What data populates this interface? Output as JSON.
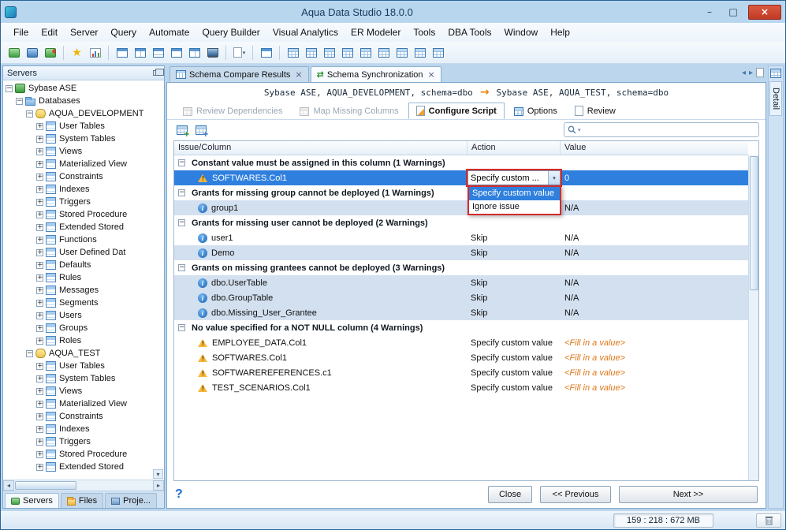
{
  "window": {
    "title": "Aqua Data Studio 18.0.0"
  },
  "titlebar": {
    "minimize": "–",
    "maximize": "□",
    "close": "×"
  },
  "menu": {
    "items": [
      "File",
      "Edit",
      "Server",
      "Query",
      "Automate",
      "Query Builder",
      "Visual Analytics",
      "ER Modeler",
      "Tools",
      "DBA Tools",
      "Window",
      "Help"
    ]
  },
  "toolbar": {
    "groups": [
      {
        "icons": [
          {
            "name": "register-server",
            "type": "server"
          },
          {
            "name": "connect-server",
            "type": "server2"
          },
          {
            "name": "server-properties",
            "type": "server3"
          }
        ]
      },
      {
        "icons": [
          {
            "name": "schema-compare",
            "type": "star"
          },
          {
            "name": "visual-analytics",
            "type": "chart"
          }
        ]
      },
      {
        "icons": [
          {
            "name": "window-tile",
            "type": "frame"
          },
          {
            "name": "window-tile-vertical",
            "type": "frame-v"
          },
          {
            "name": "window-tile-horizontal",
            "type": "frame-h"
          },
          {
            "name": "window-cascade",
            "type": "frame"
          },
          {
            "name": "window-expand",
            "type": "frame-v"
          },
          {
            "name": "monitor",
            "type": "monitor"
          }
        ]
      },
      {
        "icons": [
          {
            "name": "open-document",
            "type": "page",
            "caret": true
          }
        ]
      },
      {
        "icons": [
          {
            "name": "new-window",
            "type": "frame"
          }
        ]
      },
      {
        "icons": [
          {
            "name": "grid-results",
            "type": "grid"
          },
          {
            "name": "grid-pinned",
            "type": "grid"
          },
          {
            "name": "grid-text",
            "type": "grid"
          },
          {
            "name": "grid-form",
            "type": "grid"
          },
          {
            "name": "grid-pivot",
            "type": "grid"
          },
          {
            "name": "grid-chart",
            "type": "grid"
          },
          {
            "name": "grid-export",
            "type": "grid"
          },
          {
            "name": "grid-filter",
            "type": "grid"
          },
          {
            "name": "grid-compare",
            "type": "grid"
          }
        ]
      }
    ]
  },
  "servers_panel": {
    "title": "Servers",
    "tree": [
      {
        "label": "Sybase ASE",
        "depth": 0,
        "icon": "server",
        "expander": "minus"
      },
      {
        "label": "Databases",
        "depth": 1,
        "icon": "folder",
        "expander": "minus"
      },
      {
        "label": "AQUA_DEVELOPMENT",
        "depth": 2,
        "icon": "database",
        "expander": "minus"
      },
      {
        "label": "User Tables",
        "depth": 3,
        "icon": "category",
        "expander": "plus"
      },
      {
        "label": "System Tables",
        "depth": 3,
        "icon": "category",
        "expander": "plus"
      },
      {
        "label": "Views",
        "depth": 3,
        "icon": "category",
        "expander": "plus"
      },
      {
        "label": "Materialized View",
        "depth": 3,
        "icon": "category",
        "expander": "plus"
      },
      {
        "label": "Constraints",
        "depth": 3,
        "icon": "category",
        "expander": "plus"
      },
      {
        "label": "Indexes",
        "depth": 3,
        "icon": "category",
        "expander": "plus"
      },
      {
        "label": "Triggers",
        "depth": 3,
        "icon": "category",
        "expander": "plus"
      },
      {
        "label": "Stored Procedure",
        "depth": 3,
        "icon": "category",
        "expander": "plus"
      },
      {
        "label": "Extended Stored",
        "depth": 3,
        "icon": "category",
        "expander": "plus"
      },
      {
        "label": "Functions",
        "depth": 3,
        "icon": "category",
        "expander": "plus"
      },
      {
        "label": "User Defined Dat",
        "depth": 3,
        "icon": "category",
        "expander": "plus"
      },
      {
        "label": "Defaults",
        "depth": 3,
        "icon": "category",
        "expander": "plus"
      },
      {
        "label": "Rules",
        "depth": 3,
        "icon": "category",
        "expander": "plus"
      },
      {
        "label": "Messages",
        "depth": 3,
        "icon": "category",
        "expander": "plus"
      },
      {
        "label": "Segments",
        "depth": 3,
        "icon": "category",
        "expander": "plus"
      },
      {
        "label": "Users",
        "depth": 3,
        "icon": "category",
        "expander": "plus"
      },
      {
        "label": "Groups",
        "depth": 3,
        "icon": "category",
        "expander": "plus"
      },
      {
        "label": "Roles",
        "depth": 3,
        "icon": "category",
        "expander": "plus"
      },
      {
        "label": "AQUA_TEST",
        "depth": 2,
        "icon": "database",
        "expander": "minus"
      },
      {
        "label": "User Tables",
        "depth": 3,
        "icon": "category",
        "expander": "plus"
      },
      {
        "label": "System Tables",
        "depth": 3,
        "icon": "category",
        "expander": "plus"
      },
      {
        "label": "Views",
        "depth": 3,
        "icon": "category",
        "expander": "plus"
      },
      {
        "label": "Materialized View",
        "depth": 3,
        "icon": "category",
        "expander": "plus"
      },
      {
        "label": "Constraints",
        "depth": 3,
        "icon": "category",
        "expander": "plus"
      },
      {
        "label": "Indexes",
        "depth": 3,
        "icon": "category",
        "expander": "plus"
      },
      {
        "label": "Triggers",
        "depth": 3,
        "icon": "category",
        "expander": "plus"
      },
      {
        "label": "Stored Procedure",
        "depth": 3,
        "icon": "category",
        "expander": "plus"
      },
      {
        "label": "Extended Stored",
        "depth": 3,
        "icon": "category",
        "expander": "plus"
      }
    ],
    "bottom_tabs": [
      {
        "label": "Servers",
        "icon": "server",
        "active": true
      },
      {
        "label": "Files",
        "icon": "folder-y",
        "active": false
      },
      {
        "label": "Proje...",
        "icon": "proj",
        "active": false
      }
    ]
  },
  "document_tabs": [
    {
      "label": "Schema Compare Results",
      "icon": "grid",
      "active": false
    },
    {
      "label": "Schema Synchronization",
      "icon": "sync",
      "active": true
    }
  ],
  "sync_header": {
    "source": "Sybase ASE, AQUA_DEVELOPMENT, schema=dbo",
    "arrow": "→",
    "target": "Sybase ASE, AQUA_TEST, schema=dbo"
  },
  "wizard_tabs": [
    {
      "label": "Review Dependencies",
      "state": "disabled",
      "icon": "grid"
    },
    {
      "label": "Map Missing Columns",
      "state": "disabled",
      "icon": "grid"
    },
    {
      "label": "Configure Script",
      "state": "active",
      "icon": "script"
    },
    {
      "label": "Options",
      "state": "normal",
      "icon": "grid"
    },
    {
      "label": "Review",
      "state": "normal",
      "icon": "page"
    }
  ],
  "grid": {
    "columns": [
      "Issue/Column",
      "Action",
      "Value"
    ],
    "groups": [
      {
        "header": "Constant value must be assigned in this column (1 Warnings)",
        "rows": [
          {
            "icon": "warning",
            "label": "SOFTWARES.Col1",
            "action": "Specify custom ...",
            "value": "0",
            "selected": true,
            "combo": true
          }
        ]
      },
      {
        "header": "Grants for missing group cannot be deployed (1 Warnings)",
        "rows": [
          {
            "icon": "info",
            "label": "group1",
            "action": "",
            "value": "N/A",
            "shaded": true
          }
        ]
      },
      {
        "header": "Grants for missing user cannot be deployed (2 Warnings)",
        "rows": [
          {
            "icon": "info",
            "label": "user1",
            "action": "Skip",
            "value": "N/A"
          },
          {
            "icon": "info",
            "label": "Demo",
            "action": "Skip",
            "value": "N/A",
            "shaded": true
          }
        ]
      },
      {
        "header": "Grants on missing grantees cannot be deployed (3 Warnings)",
        "rows": [
          {
            "icon": "info",
            "label": "dbo.UserTable",
            "action": "Skip",
            "value": "N/A",
            "shaded": true
          },
          {
            "icon": "info",
            "label": "dbo.GroupTable",
            "action": "Skip",
            "value": "N/A",
            "shaded": true
          },
          {
            "icon": "info",
            "label": "dbo.Missing_User_Grantee",
            "action": "Skip",
            "value": "N/A",
            "shaded": true
          }
        ]
      },
      {
        "header": "No value specified for a NOT NULL column (4 Warnings)",
        "rows": [
          {
            "icon": "warning",
            "label": "EMPLOYEE_DATA.Col1",
            "action": "Specify custom value",
            "value": "<Fill in a value>",
            "value_style": "fill"
          },
          {
            "icon": "warning",
            "label": "SOFTWARES.Col1",
            "action": "Specify custom value",
            "value": "<Fill in a value>",
            "value_style": "fill"
          },
          {
            "icon": "warning",
            "label": "SOFTWAREREFERENCES.c1",
            "action": "Specify custom value",
            "value": "<Fill in a value>",
            "value_style": "fill"
          },
          {
            "icon": "warning",
            "label": "TEST_SCENARIOS.Col1",
            "action": "Specify custom value",
            "value": "<Fill in a value>",
            "value_style": "fill"
          }
        ]
      }
    ]
  },
  "action_dropdown": {
    "options": [
      {
        "label": "Specify custom value",
        "highlight": true
      },
      {
        "label": "Ignore issue",
        "highlight": false
      }
    ]
  },
  "search": {
    "value": ""
  },
  "footer": {
    "help": "?",
    "buttons": [
      {
        "id": "close",
        "label": "Close"
      },
      {
        "id": "previous",
        "label": "<< Previous"
      },
      {
        "id": "next",
        "label": "Next >>"
      }
    ]
  },
  "right_strip": {
    "label": "Detail"
  },
  "status_bar": {
    "memory": "159 : 218 : 672 MB"
  }
}
